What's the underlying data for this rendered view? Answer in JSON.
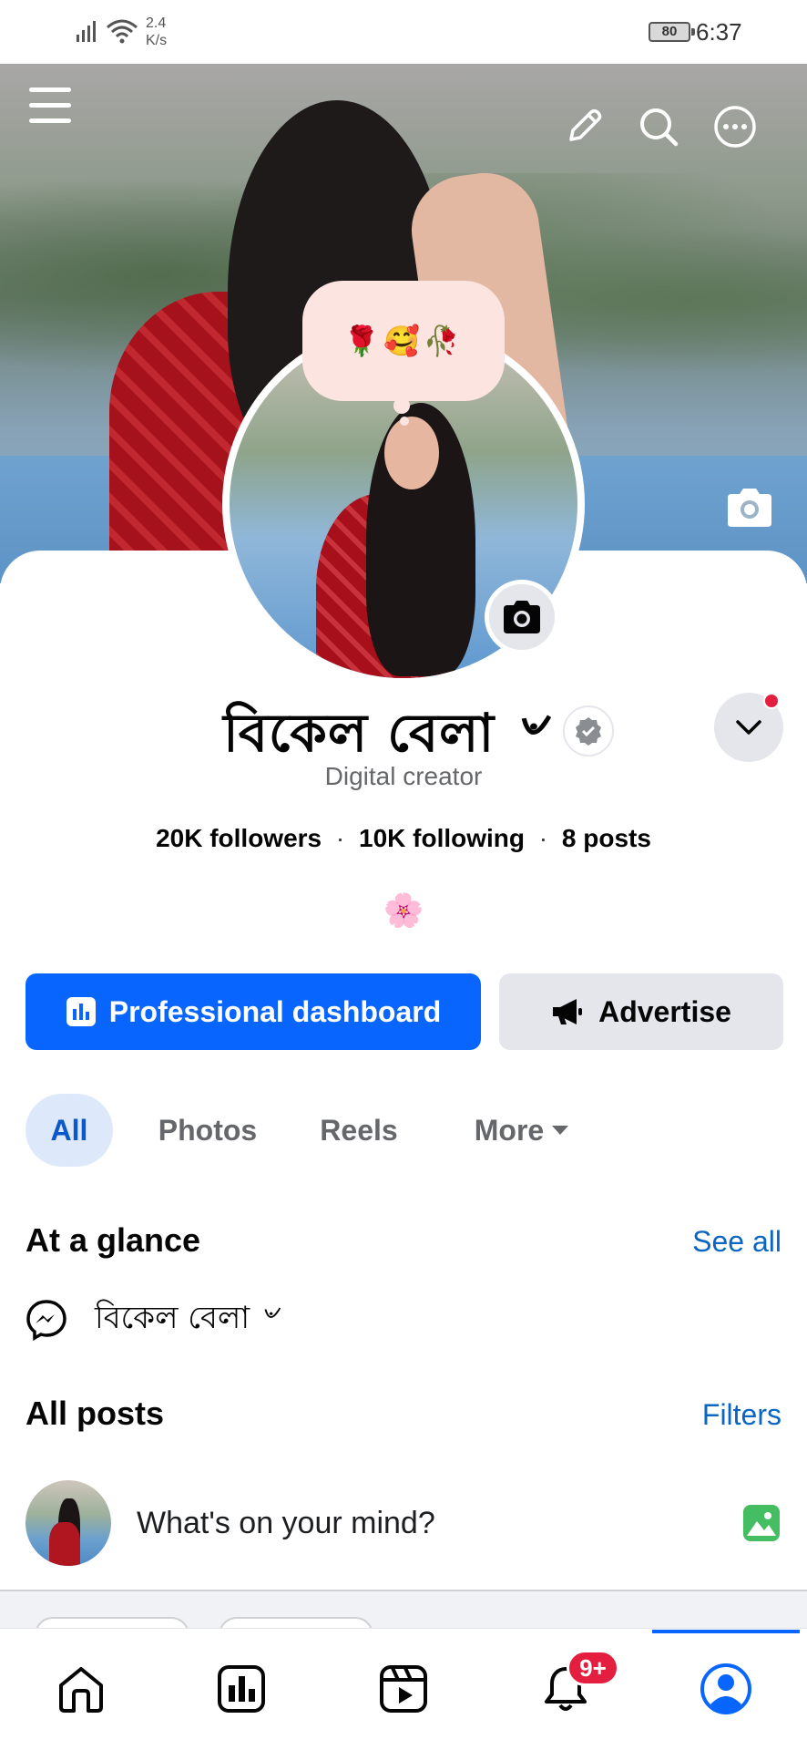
{
  "status_bar": {
    "net_speed_value": "2.4",
    "net_speed_unit": "K/s",
    "battery": "80",
    "time": "6:37"
  },
  "note": {
    "text": "🌹🥰🥀"
  },
  "profile": {
    "name": "বিকেল বেলা ৺",
    "category": "Digital creator",
    "followers": "20K followers",
    "following": "10K following",
    "posts": "8 posts",
    "separator": "·",
    "bio_emoji": "🌸"
  },
  "actions": {
    "professional_dashboard": "Professional dashboard",
    "advertise": "Advertise"
  },
  "filters": {
    "all": "All",
    "photos": "Photos",
    "reels": "Reels",
    "more": "More"
  },
  "at_a_glance": {
    "title": "At a glance",
    "see_all": "See all",
    "messenger_name": "বিকেল বেলা ৺"
  },
  "all_posts": {
    "title": "All posts",
    "filters_link": "Filters",
    "composer_placeholder": "What's on your mind?"
  },
  "bottom_nav": {
    "notification_badge": "9+",
    "active": "profile"
  },
  "colors": {
    "brand_blue": "#0866ff",
    "link_blue": "#0a66c2",
    "badge_red": "#e41e3f",
    "chip_active_bg": "#dde9fa",
    "note_bg": "#fce4e1"
  },
  "icons": [
    "menu-icon",
    "edit-icon",
    "search-icon",
    "more-icon",
    "camera-icon",
    "verified-icon",
    "chevron-down-icon",
    "dashboard-icon",
    "megaphone-icon",
    "messenger-icon",
    "photo-icon",
    "home-icon",
    "dashboard-nav-icon",
    "video-icon",
    "bell-icon",
    "profile-icon"
  ]
}
